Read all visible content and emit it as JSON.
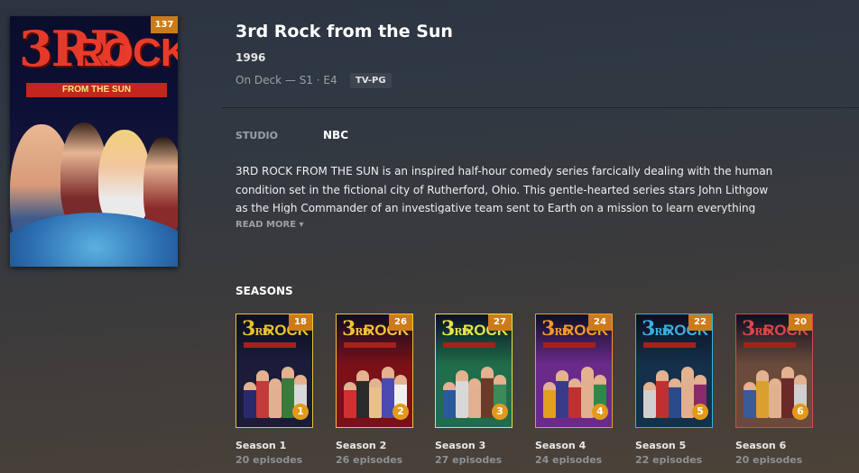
{
  "show": {
    "title": "3rd Rock from the Sun",
    "year": "1996",
    "on_deck_label": "On Deck",
    "on_deck_episode": "— S1 · E4",
    "rating": "TV-PG",
    "episode_count": "137",
    "poster_logo_3": "3RD",
    "poster_logo_rock": "ROCK",
    "poster_tagline": "FROM THE SUN",
    "studio_label": "STUDIO",
    "studio": "NBC",
    "summary": "3RD ROCK FROM THE SUN is an inspired half-hour comedy series farcically dealing with the human condition set in the fictional city of Rutherford, Ohio. This gentle-hearted series stars John Lithgow as the High Commander of an investigative team sent to Earth on a mission to learn everything about",
    "read_more": "READ MORE ▾"
  },
  "seasons_heading": "SEASONS",
  "seasons": [
    {
      "label": "Season 1",
      "episodes": "20 episodes",
      "badge": "18",
      "num": "1",
      "bg": "#1a1c3a",
      "accent": "#e8c32a"
    },
    {
      "label": "Season 2",
      "episodes": "26 episodes",
      "badge": "26",
      "num": "2",
      "bg": "#7a1018",
      "accent": "#f2c23a"
    },
    {
      "label": "Season 3",
      "episodes": "27 episodes",
      "badge": "27",
      "num": "3",
      "bg": "#1f6d4a",
      "accent": "#e6e24a"
    },
    {
      "label": "Season 4",
      "episodes": "24 episodes",
      "badge": "24",
      "num": "4",
      "bg": "#6a2a8a",
      "accent": "#f09a2a"
    },
    {
      "label": "Season 5",
      "episodes": "22 episodes",
      "badge": "22",
      "num": "5",
      "bg": "#14304a",
      "accent": "#3ab0e0"
    },
    {
      "label": "Season 6",
      "episodes": "20 episodes",
      "badge": "20",
      "num": "6",
      "bg": "#6a4a3a",
      "accent": "#d8484a"
    }
  ],
  "colors": {
    "badge": "#cc7b19",
    "accent_red": "#e53a2a"
  }
}
